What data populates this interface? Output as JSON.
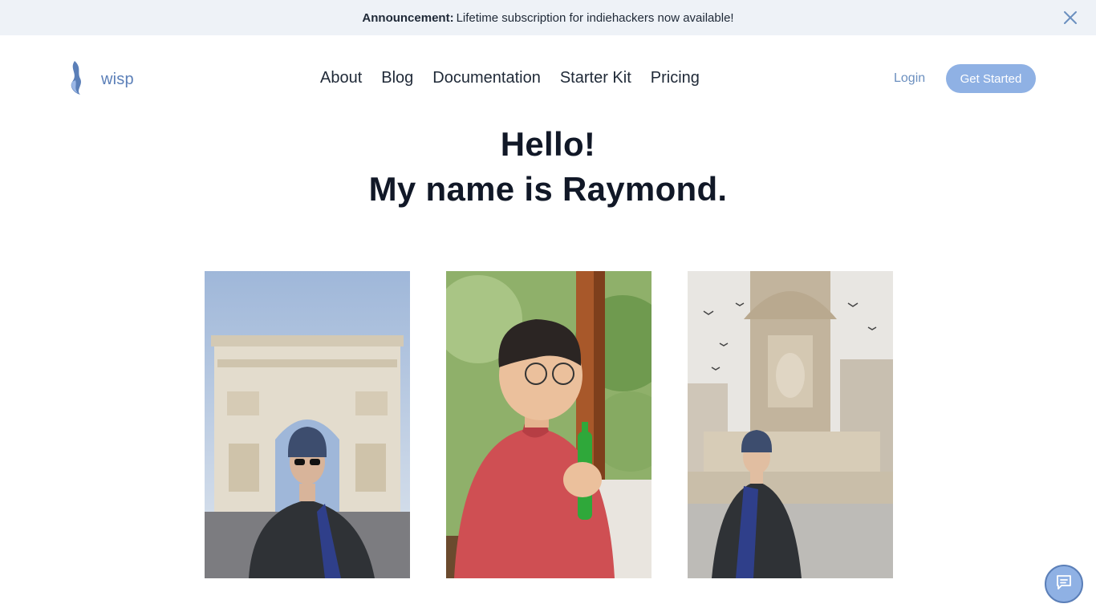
{
  "announcement": {
    "label": "Announcement:",
    "text": "Lifetime subscription for indiehackers now available!",
    "close_icon": "close-icon"
  },
  "header": {
    "brand": "wisp",
    "logo_icon": "flame-logo-icon",
    "nav": [
      "About",
      "Blog",
      "Documentation",
      "Starter Kit",
      "Pricing"
    ],
    "login_label": "Login",
    "cta_label": "Get Started"
  },
  "hero": {
    "line1": "Hello!",
    "line2": "My name is Raymond."
  },
  "photos": [
    {
      "subject": "photo-arc-de-triomphe"
    },
    {
      "subject": "photo-red-shirt-bottle"
    },
    {
      "subject": "photo-fountain"
    }
  ],
  "chat": {
    "icon": "chat-icon"
  },
  "colors": {
    "announcement_bg": "#eef2f7",
    "brand": "#5b7fb8",
    "cta_bg": "#8fb1e4",
    "text": "#111827"
  }
}
